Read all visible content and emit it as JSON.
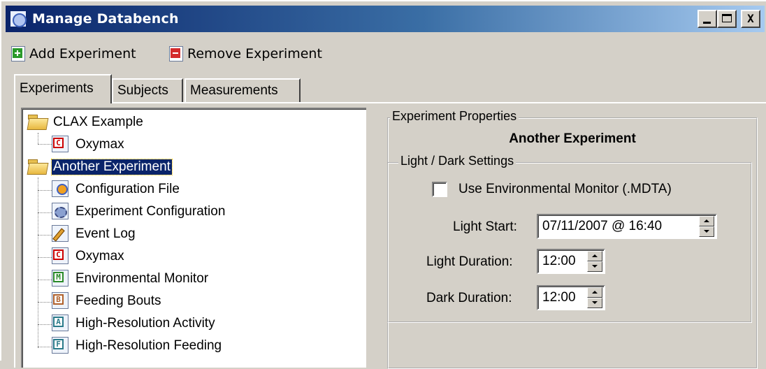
{
  "window": {
    "title": "Manage Databench",
    "caption_buttons": {
      "minimize": "_",
      "maximize": "□",
      "close": "X"
    }
  },
  "toolbar": {
    "add_label": "Add Experiment",
    "remove_label": "Remove Experiment"
  },
  "tabs": [
    {
      "label": "Experiments",
      "active": true
    },
    {
      "label": "Subjects",
      "active": false
    },
    {
      "label": "Measurements",
      "active": false
    }
  ],
  "tree": {
    "nodes": [
      {
        "label": "CLAX Example",
        "icon": "folder-icon",
        "level": 0
      },
      {
        "label": "Oxymax",
        "icon": "oxymax-doc-icon",
        "badge": "C",
        "level": 1
      },
      {
        "label": "Another Experiment",
        "icon": "folder-icon",
        "level": 0,
        "selected": true
      },
      {
        "label": "Configuration File",
        "icon": "configuration-file-icon",
        "level": 1
      },
      {
        "label": "Experiment Configuration",
        "icon": "gear-doc-icon",
        "level": 1
      },
      {
        "label": "Event Log",
        "icon": "event-log-icon",
        "level": 1
      },
      {
        "label": "Oxymax",
        "icon": "oxymax-doc-icon",
        "badge": "C",
        "level": 1
      },
      {
        "label": "Environmental Monitor",
        "icon": "environmental-monitor-icon",
        "badge": "M",
        "level": 1
      },
      {
        "label": "Feeding Bouts",
        "icon": "feeding-bouts-icon",
        "badge": "B",
        "level": 1
      },
      {
        "label": "High-Resolution Activity",
        "icon": "high-resolution-activity-icon",
        "badge": "A",
        "level": 1
      },
      {
        "label": "High-Resolution Feeding",
        "icon": "high-resolution-feeding-icon",
        "badge": "F",
        "level": 1
      }
    ]
  },
  "properties": {
    "group_label": "Experiment Properties",
    "experiment_name": "Another Experiment",
    "light_dark": {
      "group_label": "Light / Dark Settings",
      "use_env_monitor_label": "Use Environmental Monitor (.MDTA)",
      "use_env_monitor_checked": false,
      "light_start_label": "Light Start:",
      "light_start_value": "07/11/2007 @ 16:40",
      "light_duration_label": "Light Duration:",
      "light_duration_value": "12:00",
      "dark_duration_label": "Dark Duration:",
      "dark_duration_value": "12:00"
    }
  },
  "colors": {
    "titlebar_start": "#0a246a",
    "titlebar_end": "#a6caf0",
    "face": "#d4d0c8",
    "selection": "#0a246a"
  }
}
